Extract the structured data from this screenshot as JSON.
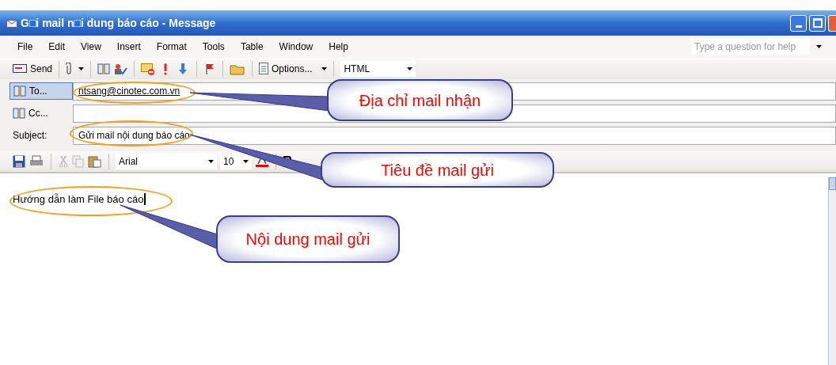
{
  "window": {
    "title": "G□i mail n□i dung báo cáo - Message"
  },
  "menu": {
    "items": [
      "File",
      "Edit",
      "View",
      "Insert",
      "Format",
      "Tools",
      "Table",
      "Window",
      "Help"
    ],
    "help_box": {
      "placeholder": "Type a question for help"
    }
  },
  "toolbar": {
    "send": "Send",
    "options": "Options...",
    "format": "HTML"
  },
  "fields": [
    {
      "label": "To...",
      "kind": "button",
      "value": "ntsang@cinotec.com.vn"
    },
    {
      "label": "Cc...",
      "kind": "button"
    },
    {
      "label": "Subject:",
      "kind": "text",
      "value": "Gửi mail nội dung báo cáo"
    }
  ],
  "format_bar": {
    "font": "Arial",
    "size": "10"
  },
  "body": {
    "text": "Hướng dẫn làm File báo cáo"
  },
  "callouts": [
    "Địa chỉ mail nhận",
    "Tiêu đề mail gửi",
    "Nội dung mail gửi"
  ]
}
